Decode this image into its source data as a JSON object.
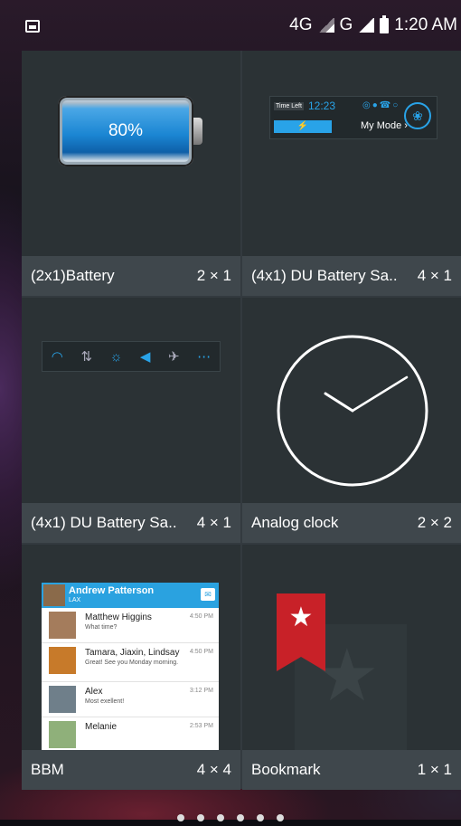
{
  "status_bar": {
    "network_4g": "4G",
    "network_g": "G",
    "time": "1:20 AM"
  },
  "widgets": [
    {
      "name": "(2x1)Battery",
      "size": "2 × 1",
      "preview": {
        "percent": "80%"
      }
    },
    {
      "name": "(4x1) DU Battery Sa..",
      "size": "4 × 1",
      "preview": {
        "time_left_label": "Time Left",
        "time": "12:23",
        "mode": "My Mode ›"
      }
    },
    {
      "name": "(4x1) DU Battery Sa..",
      "size": "4 × 1"
    },
    {
      "name": "Analog clock",
      "size": "2 × 2"
    },
    {
      "name": "BBM",
      "size": "4 × 4",
      "preview": {
        "user": "Andrew Patterson",
        "user_sub": "LAX",
        "contacts": [
          {
            "name": "Matthew Higgins",
            "message": "What time?",
            "time": "4:50 PM"
          },
          {
            "name": "Tamara, Jiaxin, Lindsay",
            "message": "Great! See you Monday morning.",
            "time": "4:50 PM"
          },
          {
            "name": "Alex",
            "message": "Most exellent!",
            "time": "3:12 PM"
          },
          {
            "name": "Melanie",
            "message": "",
            "time": "2:53 PM"
          }
        ]
      }
    },
    {
      "name": "Bookmark",
      "size": "1 × 1"
    }
  ],
  "page_indicator": {
    "count": 6,
    "active_index": 0
  }
}
